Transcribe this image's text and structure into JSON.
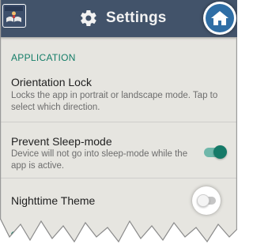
{
  "header": {
    "title": "Settings",
    "app_icon": "book-reader-icon",
    "title_icon": "gear-icon",
    "home_icon": "home-icon",
    "colors": {
      "bar": "#42536a",
      "home": "#2f6ea5"
    }
  },
  "sections": [
    {
      "header": "APPLICATION",
      "items": [
        {
          "title": "Orientation Lock",
          "description": "Locks the app in portrait or landscape mode. Tap to select which direction."
        },
        {
          "title": "Prevent Sleep-mode",
          "description": "Device will not go into sleep-mode while the app is active.",
          "switch_on": true
        },
        {
          "title": "Nighttime Theme",
          "switch_on": false
        }
      ]
    }
  ],
  "accent_color": "#147d68"
}
